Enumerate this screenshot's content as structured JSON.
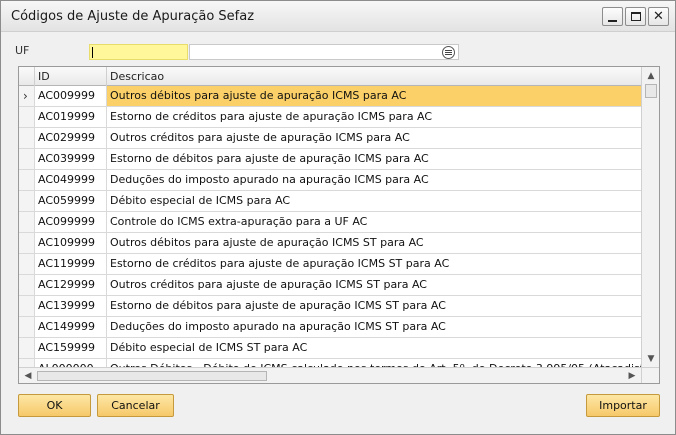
{
  "window": {
    "title": "Códigos de Ajuste de Apuração Sefaz"
  },
  "filter": {
    "label": "UF",
    "code_value": "",
    "name_value": ""
  },
  "grid": {
    "headers": {
      "selector": "",
      "id": "ID",
      "description": "Descricao"
    },
    "selected_marker": "›",
    "rows": [
      {
        "id": "AC009999",
        "desc": "Outros débitos para ajuste de apuração ICMS para AC"
      },
      {
        "id": "AC019999",
        "desc": "Estorno de créditos para ajuste de apuração ICMS para AC"
      },
      {
        "id": "AC029999",
        "desc": "Outros créditos para ajuste de apuração ICMS para AC"
      },
      {
        "id": "AC039999",
        "desc": "Estorno de débitos para ajuste de apuração ICMS para AC"
      },
      {
        "id": "AC049999",
        "desc": "Deduções do imposto apurado na apuração ICMS para AC"
      },
      {
        "id": "AC059999",
        "desc": "Débito especial de ICMS para AC"
      },
      {
        "id": "AC099999",
        "desc": "Controle do ICMS extra-apuração para a UF AC"
      },
      {
        "id": "AC109999",
        "desc": "Outros débitos para ajuste de apuração ICMS ST para AC"
      },
      {
        "id": "AC119999",
        "desc": "Estorno de créditos para ajuste de apuração ICMS ST para AC"
      },
      {
        "id": "AC129999",
        "desc": "Outros créditos para ajuste de apuração ICMS ST para AC"
      },
      {
        "id": "AC139999",
        "desc": "Estorno de débitos para ajuste de apuração ICMS ST para AC"
      },
      {
        "id": "AC149999",
        "desc": "Deduções do imposto apurado na apuração ICMS ST para AC"
      },
      {
        "id": "AC159999",
        "desc": "Débito especial de ICMS ST para AC"
      },
      {
        "id": "AL000000",
        "desc": "Outros Débitos - Débito de ICMS calculado nos termos do Art. 5º, do Decreto 3.995/05 (Atacadistas de Medicam"
      }
    ]
  },
  "buttons": {
    "ok": "OK",
    "cancel": "Cancelar",
    "import": "Importar"
  },
  "colors": {
    "selected_row": "#fbd068",
    "active_field": "#fff79a",
    "button_face": "#f6c96a"
  }
}
